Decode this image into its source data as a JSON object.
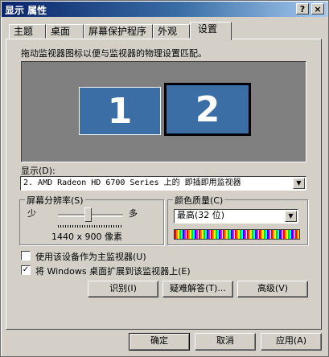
{
  "window": {
    "title": "显示 属性",
    "help_btn": "?",
    "close_btn": "×"
  },
  "tabs": [
    {
      "label": "主题"
    },
    {
      "label": "桌面"
    },
    {
      "label": "屏幕保护程序"
    },
    {
      "label": "外观"
    },
    {
      "label": "设置"
    }
  ],
  "settings": {
    "instruction": "拖动监视器图标以便与监视器的物理设置匹配。",
    "monitors": [
      "1",
      "2"
    ],
    "display_label": "显示(D):",
    "display_value": "2. AMD Radeon HD 6700 Series  上的 即插即用监视器",
    "resolution": {
      "label": "屏幕分辨率(S)",
      "less": "少",
      "more": "多",
      "value": "1440 x 900 像素",
      "slider_position": 0.45
    },
    "color_quality": {
      "label": "颜色质量(C)",
      "value": "最高(32 位)"
    },
    "checkbox_primary": {
      "label": "使用该设备作为主监视器(U)",
      "checked": false
    },
    "checkbox_extend": {
      "label": "将 Windows 桌面扩展到该监视器上(E)",
      "checked": true
    },
    "buttons": {
      "identify": "识别(I)",
      "troubleshoot": "疑难解答(T)...",
      "advanced": "高级(V)"
    }
  },
  "footer": {
    "ok": "确定",
    "cancel": "取消",
    "apply": "应用(A)"
  }
}
